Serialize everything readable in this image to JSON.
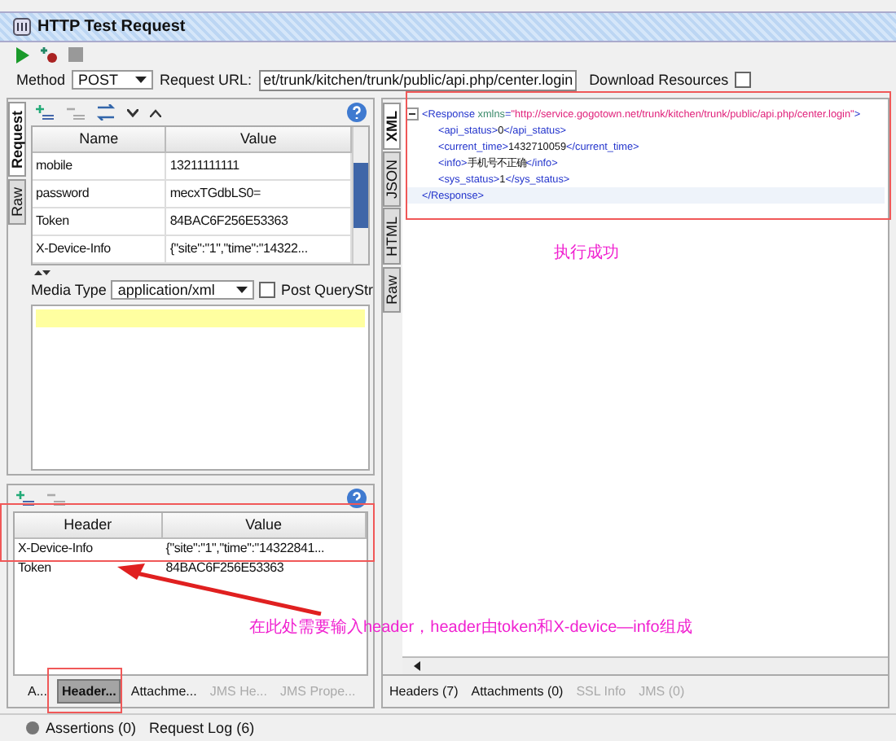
{
  "window": {
    "title": "HTTP Test Request"
  },
  "request_bar": {
    "method_label": "Method",
    "method": "POST",
    "url_label": "Request URL:",
    "url": "et/trunk/kitchen/trunk/public/api.php/center.login",
    "download_label": "Download Resources",
    "download_checked": false
  },
  "request_panel": {
    "side_tabs": [
      {
        "label": "Request",
        "selected": true
      },
      {
        "label": "Raw",
        "selected": false
      }
    ],
    "params": {
      "columns": [
        "Name",
        "Value"
      ],
      "rows": [
        {
          "name": "mobile",
          "value": "13211111111"
        },
        {
          "name": "password",
          "value": "mecxTGdbLS0="
        },
        {
          "name": "Token",
          "value": "84BAC6F256E53363"
        },
        {
          "name": "X-Device-Info",
          "value": "{\"site\":\"1\",\"time\":\"14322..."
        }
      ]
    },
    "media_type_label": "Media Type",
    "media_type": "application/xml",
    "post_querystring": {
      "label": "Post QueryStr",
      "checked": false
    },
    "headers": {
      "columns": [
        "Header",
        "Value"
      ],
      "rows": [
        {
          "name": "X-Device-Info",
          "value": "{\"site\":\"1\",\"time\":\"14322841..."
        },
        {
          "name": "Token",
          "value": "84BAC6F256E53363"
        }
      ]
    },
    "bottom_tabs": [
      {
        "label": "A...",
        "selected": false,
        "disabled": false
      },
      {
        "label": "Header...",
        "selected": true,
        "disabled": false
      },
      {
        "label": "Attachme...",
        "selected": false,
        "disabled": false
      },
      {
        "label": "JMS He...",
        "selected": false,
        "disabled": true
      },
      {
        "label": "JMS Prope...",
        "selected": false,
        "disabled": true
      }
    ]
  },
  "response_panel": {
    "side_tabs": [
      {
        "label": "XML",
        "selected": true
      },
      {
        "label": "JSON",
        "selected": false
      },
      {
        "label": "HTML",
        "selected": false
      },
      {
        "label": "Raw",
        "selected": false
      }
    ],
    "xml": {
      "open": [
        {
          "kind": "tag",
          "text": "<Response"
        },
        {
          "kind": "attr",
          "text": " xmlns"
        },
        {
          "kind": "tag",
          "text": "="
        },
        {
          "kind": "string",
          "text": "\"http://service.gogotown.net/trunk/kitchen/trunk/public/api.php/center.login\""
        },
        {
          "kind": "tag",
          "text": ">"
        }
      ],
      "children": [
        {
          "parts": [
            {
              "kind": "tag",
              "text": "<api_status>"
            },
            {
              "kind": "value",
              "text": "0"
            },
            {
              "kind": "tag",
              "text": "</api_status>"
            }
          ]
        },
        {
          "parts": [
            {
              "kind": "tag",
              "text": "<current_time>"
            },
            {
              "kind": "value",
              "text": "1432710059"
            },
            {
              "kind": "tag",
              "text": "</current_time>"
            }
          ]
        },
        {
          "parts": [
            {
              "kind": "tag",
              "text": "<info>"
            },
            {
              "kind": "value",
              "text": "手机号不正确"
            },
            {
              "kind": "tag",
              "text": "</info>"
            }
          ]
        },
        {
          "parts": [
            {
              "kind": "tag",
              "text": "<sys_status>"
            },
            {
              "kind": "value",
              "text": "1"
            },
            {
              "kind": "tag",
              "text": "</sys_status>"
            }
          ]
        }
      ],
      "close": [
        {
          "kind": "tag",
          "text": "</Response>"
        }
      ]
    },
    "bottom_tabs": [
      {
        "label": "Headers (7)",
        "disabled": false
      },
      {
        "label": "Attachments (0)",
        "disabled": false
      },
      {
        "label": "SSL Info",
        "disabled": true
      },
      {
        "label": "JMS (0)",
        "disabled": true
      }
    ]
  },
  "status_bar": [
    {
      "label": "Assertions (0)",
      "kind": "dot"
    },
    {
      "label": "Request Log (6)",
      "kind": "plain"
    }
  ],
  "annotations": [
    {
      "kind": "note",
      "text": "执行成功"
    },
    {
      "kind": "callout",
      "text": "在此处需要输入header，header由token和X-device—info组成"
    }
  ]
}
